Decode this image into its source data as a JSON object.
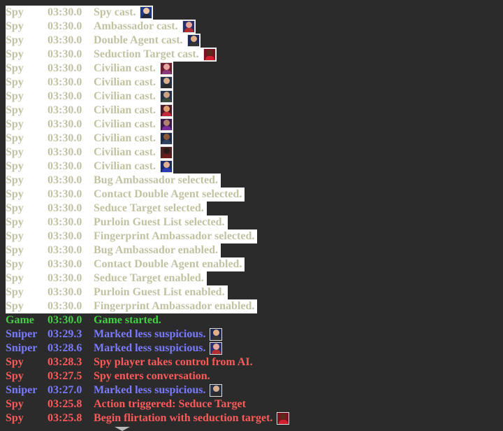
{
  "colors": {
    "background": "#2b2b2b",
    "highlight": "#ffffff",
    "setup_text": "#c2c2a3",
    "game_text": "#44d044",
    "sniper_text": "#7a7aff",
    "spy_text": "#ff5a5a"
  },
  "entries": [
    {
      "actor": "Spy",
      "time": "03:30.0",
      "text": "Spy cast.",
      "kind": "setup",
      "portrait": {
        "icon": "spy-portrait-icon",
        "bg": "#1c3a86",
        "skin": "#f1c6a6",
        "outfit": "#22283a"
      }
    },
    {
      "actor": "Spy",
      "time": "03:30.0",
      "text": "Ambassador cast.",
      "kind": "setup",
      "portrait": {
        "icon": "ambassador-portrait-icon",
        "bg": "#2a2f6e",
        "skin": "#e8a89a",
        "outfit": "#b03030"
      }
    },
    {
      "actor": "Spy",
      "time": "03:30.0",
      "text": "Double Agent cast.",
      "kind": "setup",
      "portrait": {
        "icon": "double-agent-portrait-icon",
        "bg": "#1d2a55",
        "skin": "#e2b086",
        "outfit": "#333333"
      }
    },
    {
      "actor": "Spy",
      "time": "03:30.0",
      "text": "Seduction Target cast.",
      "kind": "setup",
      "portrait": {
        "icon": "seduction-target-portrait-icon",
        "bg": "#7a1020",
        "skin": "#5a2a1a",
        "outfit": "#d02030"
      }
    },
    {
      "actor": "Spy",
      "time": "03:30.0",
      "text": "Civilian cast.",
      "kind": "setup",
      "portrait": {
        "icon": "civilian-portrait-icon",
        "bg": "#6b1e2e",
        "skin": "#e7a6a0",
        "outfit": "#8a3a7a"
      }
    },
    {
      "actor": "Spy",
      "time": "03:30.0",
      "text": "Civilian cast.",
      "kind": "setup",
      "portrait": {
        "icon": "civilian-portrait-icon",
        "bg": "#26324a",
        "skin": "#d9b08e",
        "outfit": "#2a2a2a"
      }
    },
    {
      "actor": "Spy",
      "time": "03:30.0",
      "text": "Civilian cast.",
      "kind": "setup",
      "portrait": {
        "icon": "civilian-portrait-icon",
        "bg": "#22304a",
        "skin": "#caa184",
        "outfit": "#3b4b3b"
      }
    },
    {
      "actor": "Spy",
      "time": "03:30.0",
      "text": "Civilian cast.",
      "kind": "setup",
      "portrait": {
        "icon": "civilian-portrait-icon",
        "bg": "#4a1a2a",
        "skin": "#e0a070",
        "outfit": "#c02a3a"
      }
    },
    {
      "actor": "Spy",
      "time": "03:30.0",
      "text": "Civilian cast.",
      "kind": "setup",
      "portrait": {
        "icon": "civilian-portrait-icon",
        "bg": "#3a1a4a",
        "skin": "#b08070",
        "outfit": "#7a2a9a"
      }
    },
    {
      "actor": "Spy",
      "time": "03:30.0",
      "text": "Civilian cast.",
      "kind": "setup",
      "portrait": {
        "icon": "civilian-portrait-icon",
        "bg": "#1e2a44",
        "skin": "#8a5a3a",
        "outfit": "#304060"
      }
    },
    {
      "actor": "Spy",
      "time": "03:30.0",
      "text": "Civilian cast.",
      "kind": "setup",
      "portrait": {
        "icon": "civilian-portrait-icon",
        "bg": "#4a2020",
        "skin": "#2a1a1a",
        "outfit": "#6a1a1a"
      }
    },
    {
      "actor": "Spy",
      "time": "03:30.0",
      "text": "Civilian cast.",
      "kind": "setup",
      "portrait": {
        "icon": "civilian-portrait-icon",
        "bg": "#1a2a6a",
        "skin": "#e0b090",
        "outfit": "#2a3ab0"
      }
    },
    {
      "actor": "Spy",
      "time": "03:30.0",
      "text": "Bug Ambassador selected.",
      "kind": "setup"
    },
    {
      "actor": "Spy",
      "time": "03:30.0",
      "text": "Contact Double Agent selected.",
      "kind": "setup"
    },
    {
      "actor": "Spy",
      "time": "03:30.0",
      "text": "Seduce Target selected.",
      "kind": "setup"
    },
    {
      "actor": "Spy",
      "time": "03:30.0",
      "text": "Purloin Guest List selected.",
      "kind": "setup"
    },
    {
      "actor": "Spy",
      "time": "03:30.0",
      "text": "Fingerprint Ambassador selected.",
      "kind": "setup"
    },
    {
      "actor": "Spy",
      "time": "03:30.0",
      "text": "Bug Ambassador enabled.",
      "kind": "setup"
    },
    {
      "actor": "Spy",
      "time": "03:30.0",
      "text": "Contact Double Agent enabled.",
      "kind": "setup"
    },
    {
      "actor": "Spy",
      "time": "03:30.0",
      "text": "Seduce Target enabled.",
      "kind": "setup"
    },
    {
      "actor": "Spy",
      "time": "03:30.0",
      "text": "Purloin Guest List enabled.",
      "kind": "setup"
    },
    {
      "actor": "Spy",
      "time": "03:30.0",
      "text": "Fingerprint Ambassador enabled.",
      "kind": "setup"
    },
    {
      "actor": "Game",
      "time": "03:30.0",
      "text": "Game started.",
      "kind": "game"
    },
    {
      "actor": "Sniper",
      "time": "03:29.3",
      "text": "Marked less suspicious.",
      "kind": "sniper",
      "portrait": {
        "icon": "double-agent-portrait-icon",
        "bg": "#1d2a55",
        "skin": "#e2b086",
        "outfit": "#333333"
      }
    },
    {
      "actor": "Sniper",
      "time": "03:28.6",
      "text": "Marked less suspicious.",
      "kind": "sniper",
      "portrait": {
        "icon": "ambassador-portrait-icon",
        "bg": "#2a2f6e",
        "skin": "#e8a89a",
        "outfit": "#b03030"
      }
    },
    {
      "actor": "Spy",
      "time": "03:28.3",
      "text": "Spy player takes control from AI.",
      "kind": "spy"
    },
    {
      "actor": "Spy",
      "time": "03:27.5",
      "text": "Spy enters conversation.",
      "kind": "spy"
    },
    {
      "actor": "Sniper",
      "time": "03:27.0",
      "text": "Marked less suspicious.",
      "kind": "sniper",
      "portrait": {
        "icon": "civilian-portrait-icon",
        "bg": "#26324a",
        "skin": "#d9b08e",
        "outfit": "#2a2a2a"
      }
    },
    {
      "actor": "Spy",
      "time": "03:25.8",
      "text": "Action triggered: Seduce Target",
      "kind": "spy"
    },
    {
      "actor": "Spy",
      "time": "03:25.8",
      "text": "Begin flirtation with seduction target.",
      "kind": "spy",
      "portrait": {
        "icon": "seduction-target-portrait-icon",
        "bg": "#7a1020",
        "skin": "#5a2a1a",
        "outfit": "#d02030"
      }
    }
  ]
}
